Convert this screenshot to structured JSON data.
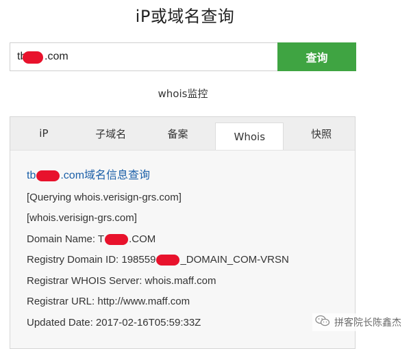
{
  "header": {
    "title": "iP或域名查询"
  },
  "search": {
    "value_prefix": "tb",
    "value_suffix": ".com",
    "button_label": "查询"
  },
  "monitor": {
    "label": "whois监控"
  },
  "tabs": [
    {
      "label": "iP",
      "active": false
    },
    {
      "label": "子域名",
      "active": false
    },
    {
      "label": "备案",
      "active": false
    },
    {
      "label": "Whois",
      "active": true
    },
    {
      "label": "快照",
      "active": false
    }
  ],
  "whois": {
    "heading_prefix": "tb",
    "heading_suffix": ".com域名信息查询",
    "line1": "[Querying whois.verisign-grs.com]",
    "line2": "[whois.verisign-grs.com]",
    "domain_name_label": "Domain Name: T",
    "domain_name_suffix": ".COM",
    "registry_id_label": "Registry Domain ID: 198559",
    "registry_id_suffix": "_DOMAIN_COM-VRSN",
    "registrar_whois": "Registrar WHOIS Server: whois.maff.com",
    "registrar_url": "Registrar URL: http://www.maff.com",
    "updated_date": "Updated Date: 2017-02-16T05:59:33Z"
  },
  "watermark": {
    "text": "拼客院长陈鑫杰",
    "icon": "wechat-icon"
  },
  "colors": {
    "accent": "#3fa442",
    "link": "#1b5fa8",
    "redaction": "#e8122c"
  }
}
